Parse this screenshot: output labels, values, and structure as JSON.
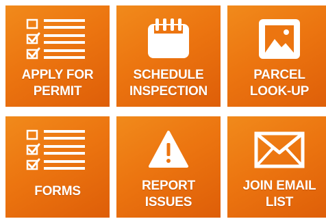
{
  "tiles": [
    {
      "icon": "checklist-icon",
      "line1": "APPLY FOR",
      "line2": "PERMIT"
    },
    {
      "icon": "calendar-icon",
      "line1": "SCHEDULE",
      "line2": "INSPECTION"
    },
    {
      "icon": "image-icon",
      "line1": "PARCEL",
      "line2": "LOOK-UP"
    },
    {
      "icon": "checklist-icon",
      "line1": "FORMS",
      "line2": ""
    },
    {
      "icon": "warning-icon",
      "line1": "REPORT",
      "line2": "ISSUES"
    },
    {
      "icon": "envelope-icon",
      "line1": "JOIN EMAIL",
      "line2": "LIST"
    }
  ],
  "colors": {
    "tile_top": "#f18a1b",
    "tile_bottom": "#de5e08",
    "text": "#ffffff"
  }
}
